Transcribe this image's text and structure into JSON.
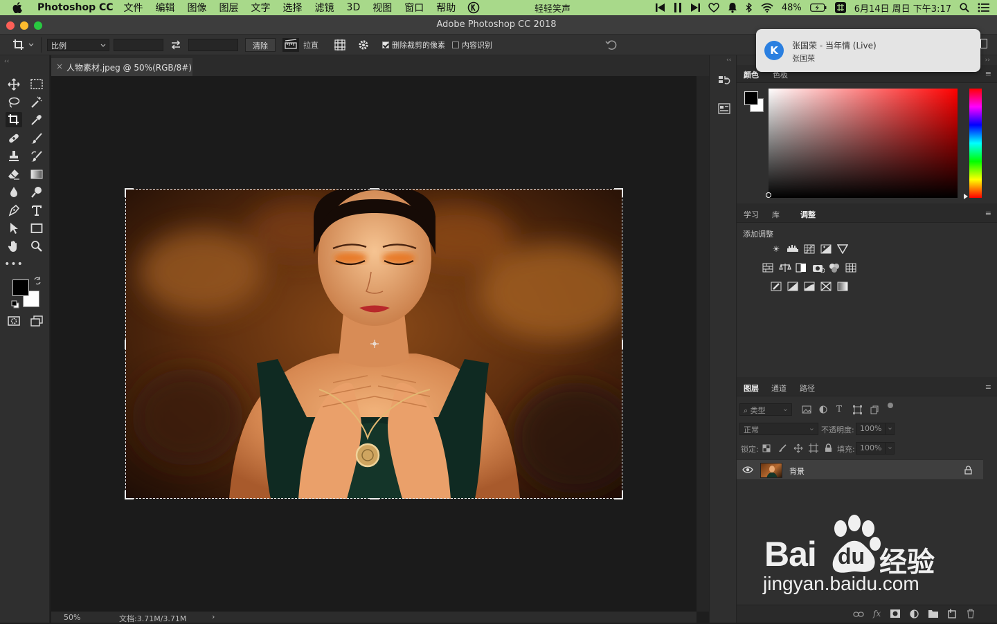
{
  "menubar": {
    "app_name": "Photoshop CC",
    "menus": [
      "文件",
      "编辑",
      "图像",
      "图层",
      "文字",
      "选择",
      "滤镜",
      "3D",
      "视图",
      "窗口",
      "帮助"
    ],
    "song": "轻轻笑声",
    "battery": "48%",
    "datetime": "6月14日 周日 下午3:17"
  },
  "window": {
    "title": "Adobe Photoshop CC 2018"
  },
  "options": {
    "ratio_label": "比例",
    "clear_label": "清除",
    "straighten_label": "拉直",
    "delete_cropped_label": "删除裁剪的像素",
    "delete_cropped_checked": true,
    "content_aware_label": "内容识别",
    "content_aware_checked": false
  },
  "notification": {
    "title": "张国荣 - 当年情 (Live)",
    "subtitle": "张国荣",
    "app_icon_letter": "K"
  },
  "document": {
    "tab_title": "人物素材.jpeg @ 50%(RGB/8#)",
    "zoom": "50%",
    "doc_size": "文档:3.71M/3.71M"
  },
  "color_panel": {
    "tabs": [
      "颜色",
      "色板"
    ],
    "hue_color": "#ff0000"
  },
  "adjust_panel": {
    "tabs": [
      "学习",
      "库",
      "调整"
    ],
    "add_label": "添加调整"
  },
  "layers_panel": {
    "tabs": [
      "图层",
      "通道",
      "路径"
    ],
    "filter_label": "类型",
    "blend_mode": "正常",
    "opacity_label": "不透明度:",
    "opacity_value": "100%",
    "lock_label": "锁定:",
    "fill_label": "填充:",
    "fill_value": "100%",
    "layers": [
      {
        "name": "背景",
        "visible": true,
        "locked": true
      }
    ]
  },
  "watermark": {
    "brand": "Bai",
    "brand2": "du",
    "cn": "经验",
    "url": "jingyan.baidu.com"
  }
}
